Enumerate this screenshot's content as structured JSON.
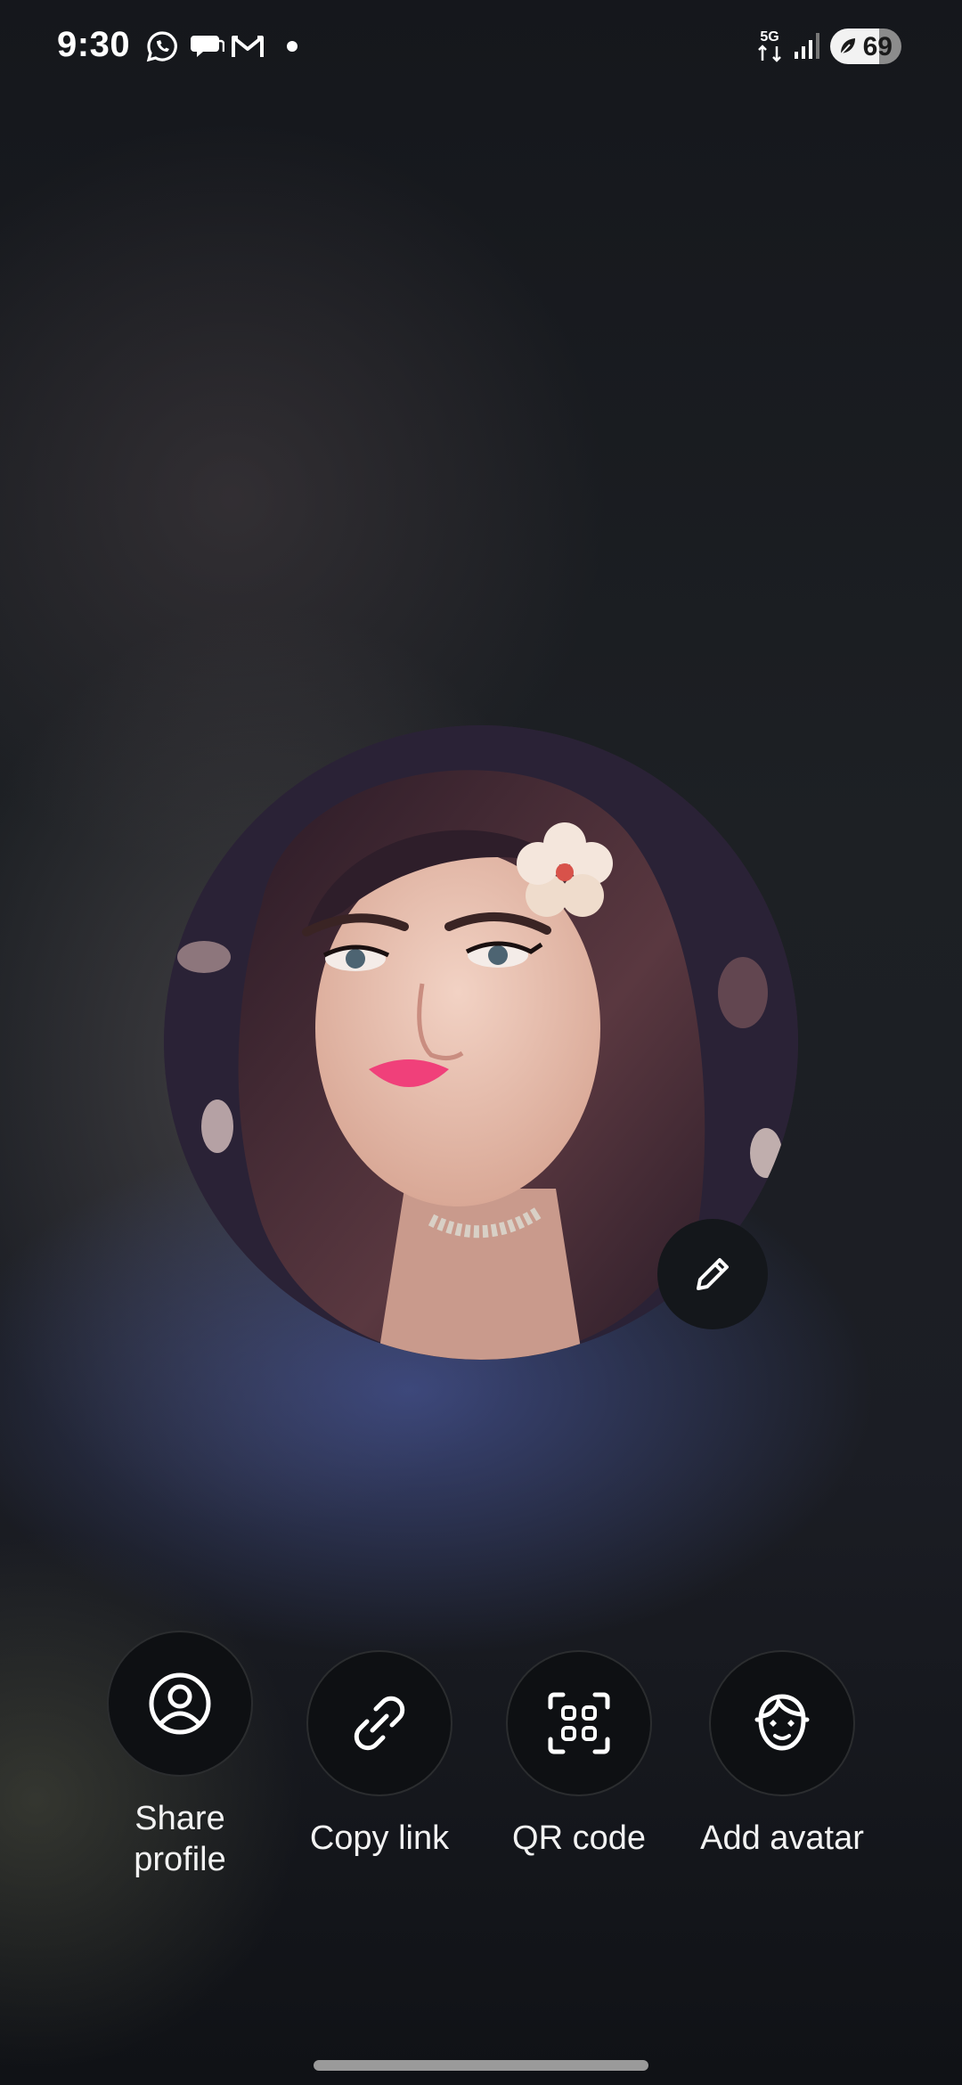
{
  "status_bar": {
    "time": "9:30",
    "notification_icons": [
      "whatsapp-icon",
      "messages-icon",
      "gmail-icon"
    ],
    "network": "5G",
    "battery_level": "69"
  },
  "profile": {
    "avatar_image": "profile-photo",
    "edit_icon": "pencil-icon"
  },
  "actions": [
    {
      "label": "Share\nprofile",
      "icon": "person-circle-icon"
    },
    {
      "label": "Copy link",
      "icon": "link-icon"
    },
    {
      "label": "QR code",
      "icon": "qr-scan-icon"
    },
    {
      "label": "Add avatar",
      "icon": "avatar-face-icon"
    }
  ],
  "colors": {
    "button_bg": "#0e1013",
    "accent_glow": "#4654a0"
  }
}
